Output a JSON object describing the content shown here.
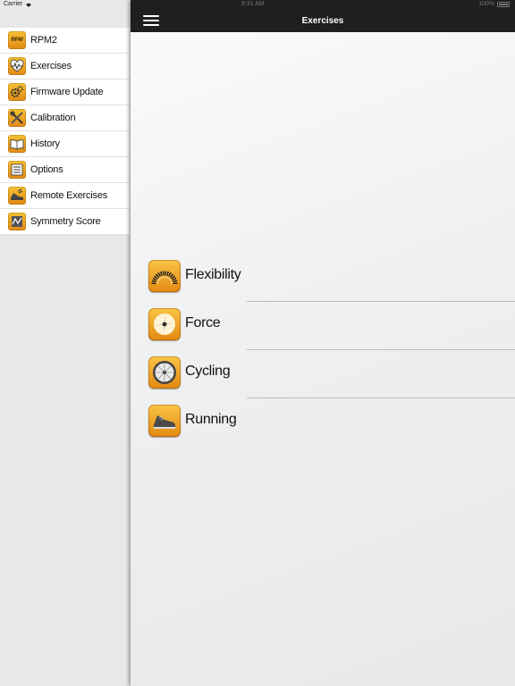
{
  "status_bar": {
    "carrier": "Carrier",
    "time": "9:31 AM",
    "battery": "100%"
  },
  "nav": {
    "title": "Exercises"
  },
  "sidebar": {
    "items": [
      {
        "label": "RPM2",
        "icon": "rpm-logo-icon",
        "icon_text": "RPM"
      },
      {
        "label": "Exercises",
        "icon": "heart-monitor-icon"
      },
      {
        "label": "Firmware Update",
        "icon": "gears-icon"
      },
      {
        "label": "Calibration",
        "icon": "tools-icon"
      },
      {
        "label": "History",
        "icon": "book-icon"
      },
      {
        "label": "Options",
        "icon": "list-icon"
      },
      {
        "label": "Remote Exercises",
        "icon": "remote-shoe-icon"
      },
      {
        "label": "Symmetry Score",
        "icon": "symmetry-chart-icon"
      }
    ]
  },
  "exercises": [
    {
      "label": "Flexibility",
      "icon": "spring-icon"
    },
    {
      "label": "Force",
      "icon": "force-burst-icon"
    },
    {
      "label": "Cycling",
      "icon": "wheel-icon"
    },
    {
      "label": "Running",
      "icon": "shoe-icon"
    }
  ],
  "colors": {
    "accent_orange": "#f0a020",
    "nav_bar": "#1f1f1f"
  }
}
